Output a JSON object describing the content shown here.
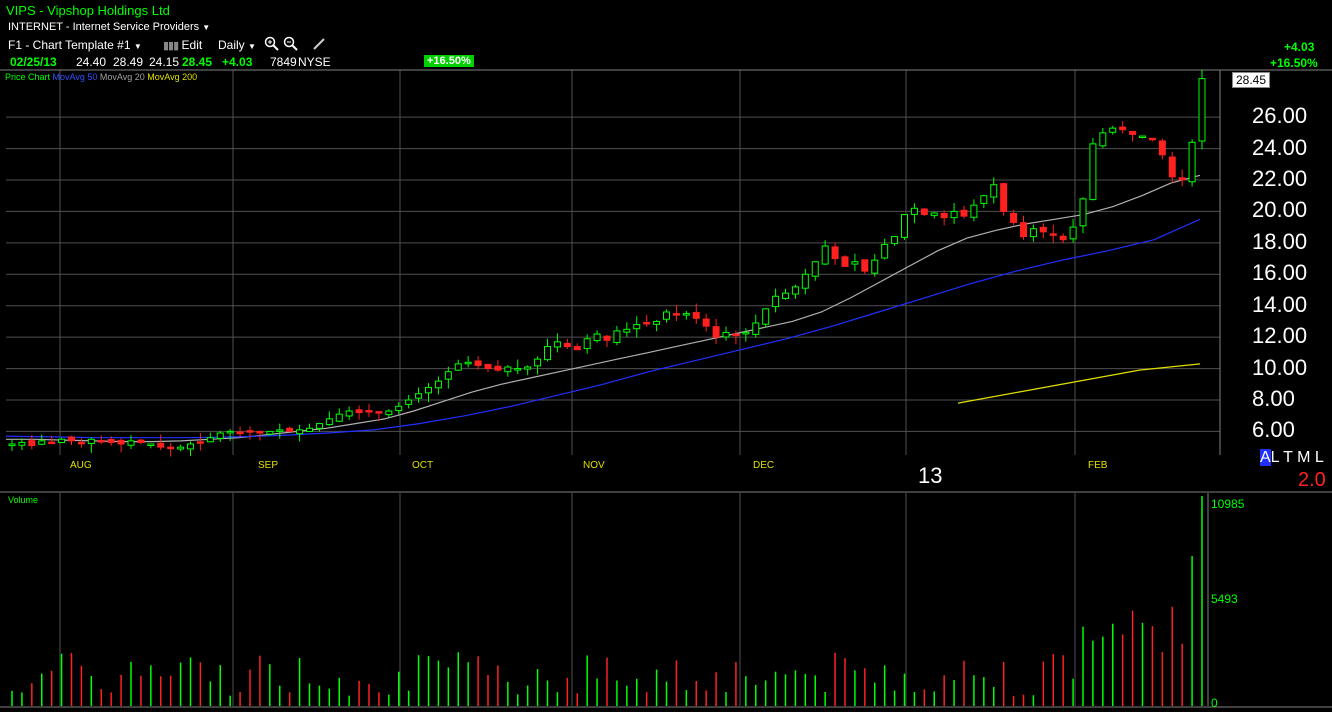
{
  "header": {
    "symbol_title": "VIPS - Vipshop Holdings Ltd",
    "industry": "INTERNET - Internet Service Providers",
    "template": "F1 - Chart Template #1",
    "edit_label": "Edit",
    "period": "Daily",
    "change_abs": "+4.03",
    "change_pct": "+16.50%"
  },
  "quote": {
    "date": "02/25/13",
    "open": "24.40",
    "high": "28.49",
    "low": "24.15",
    "close": "28.45",
    "change": "+4.03",
    "volume": "7849",
    "exchange": "NYSE",
    "pct_badge": "+16.50%"
  },
  "legend": {
    "price": "Price Chart",
    "ma50": "MovAvg 50",
    "ma20": "MovAvg 20",
    "ma200": "MovAvg 200"
  },
  "last_price": "28.45",
  "x_labels": [
    "AUG",
    "SEP",
    "OCT",
    "NOV",
    "DEC",
    "FEB"
  ],
  "year_label": "13",
  "altml": {
    "a": "A",
    "rest": "L T M L"
  },
  "version": "2.0",
  "volume_label": "Volume",
  "colors": {
    "up": "#00ff00",
    "down": "#ff2020",
    "ma20": "#b0b0b0",
    "ma50": "#2030ff",
    "ma200": "#e0e000",
    "grid": "#505050"
  },
  "chart_data": [
    {
      "type": "candlestick",
      "title": "VIPS - Vipshop Holdings Ltd",
      "ylim": [
        4.5,
        29
      ],
      "y_ticks": [
        "26.00",
        "24.00",
        "22.00",
        "20.00",
        "18.00",
        "16.00",
        "14.00",
        "12.00",
        "10.00",
        "8.00",
        "6.00"
      ],
      "x_categories": [
        "AUG",
        "SEP",
        "OCT",
        "NOV",
        "DEC",
        "13",
        "FEB"
      ],
      "series": [
        {
          "name": "Price Chart",
          "close": [
            5.2,
            5.3,
            5.1,
            5.4,
            5.3,
            5.5,
            5.4,
            5.3,
            5.5,
            5.4,
            5.3,
            5.2,
            5.4,
            5.3,
            5.2,
            5.0,
            4.9,
            5.0,
            5.2,
            5.3,
            5.6,
            5.9,
            6.0,
            5.9,
            6.0,
            5.9,
            6.0,
            6.1,
            6.0,
            6.1,
            6.2,
            6.5,
            6.8,
            7.1,
            7.3,
            7.2,
            7.3,
            7.2,
            7.3,
            7.6,
            8.0,
            8.4,
            8.8,
            9.2,
            9.8,
            10.3,
            10.4,
            10.2,
            10.0,
            9.9,
            10.1,
            10.0,
            10.1,
            10.6,
            11.4,
            11.7,
            11.4,
            11.2,
            11.9,
            12.2,
            11.8,
            12.4,
            12.5,
            12.8,
            12.9,
            13.0,
            13.6,
            13.4,
            13.5,
            13.2,
            12.7,
            12.0,
            12.3,
            12.1,
            12.3,
            12.9,
            13.8,
            14.6,
            14.8,
            15.2,
            16.0,
            16.8,
            17.8,
            17.0,
            16.5,
            16.8,
            16.2,
            16.9,
            17.9,
            18.4,
            19.8,
            20.2,
            19.8,
            19.9,
            19.6,
            20.0,
            19.7,
            20.4,
            21.0,
            21.7,
            20.0,
            19.3,
            18.4,
            18.9,
            18.7,
            18.5,
            18.2,
            19.0,
            20.8,
            24.3,
            25.0,
            25.3,
            25.2,
            24.9,
            24.8,
            24.6,
            23.6,
            22.2,
            22.0,
            24.4,
            28.45
          ]
        },
        {
          "name": "MovAvg 20",
          "values": [
            5.5,
            5.5,
            5.45,
            5.4,
            5.35,
            5.35,
            5.4,
            5.5,
            5.6,
            5.8,
            6.0,
            6.2,
            6.5,
            6.8,
            7.3,
            7.9,
            8.5,
            9.0,
            9.4,
            9.8,
            10.2,
            10.6,
            11.0,
            11.4,
            11.8,
            12.2,
            12.6,
            13.0,
            13.6,
            14.5,
            15.5,
            16.5,
            17.5,
            18.3,
            18.8,
            19.2,
            19.5,
            19.8,
            20.3,
            21.0,
            21.8,
            22.3
          ]
        },
        {
          "name": "MovAvg 50",
          "values": [
            5.7,
            5.65,
            5.6,
            5.6,
            5.6,
            5.65,
            5.75,
            5.9,
            6.1,
            6.5,
            7.0,
            7.6,
            8.3,
            9.0,
            9.8,
            10.5,
            11.2,
            11.9,
            12.7,
            13.6,
            14.5,
            15.4,
            16.2,
            16.9,
            17.5,
            18.2,
            19.5
          ]
        },
        {
          "name": "MovAvg 200",
          "values": [
            7.8,
            8.5,
            9.2,
            9.9,
            10.3
          ]
        },
        {
          "name": "Volume",
          "ylim": [
            0,
            10985
          ],
          "y_ticks": [
            "10985",
            "5493",
            "0"
          ]
        }
      ]
    }
  ]
}
